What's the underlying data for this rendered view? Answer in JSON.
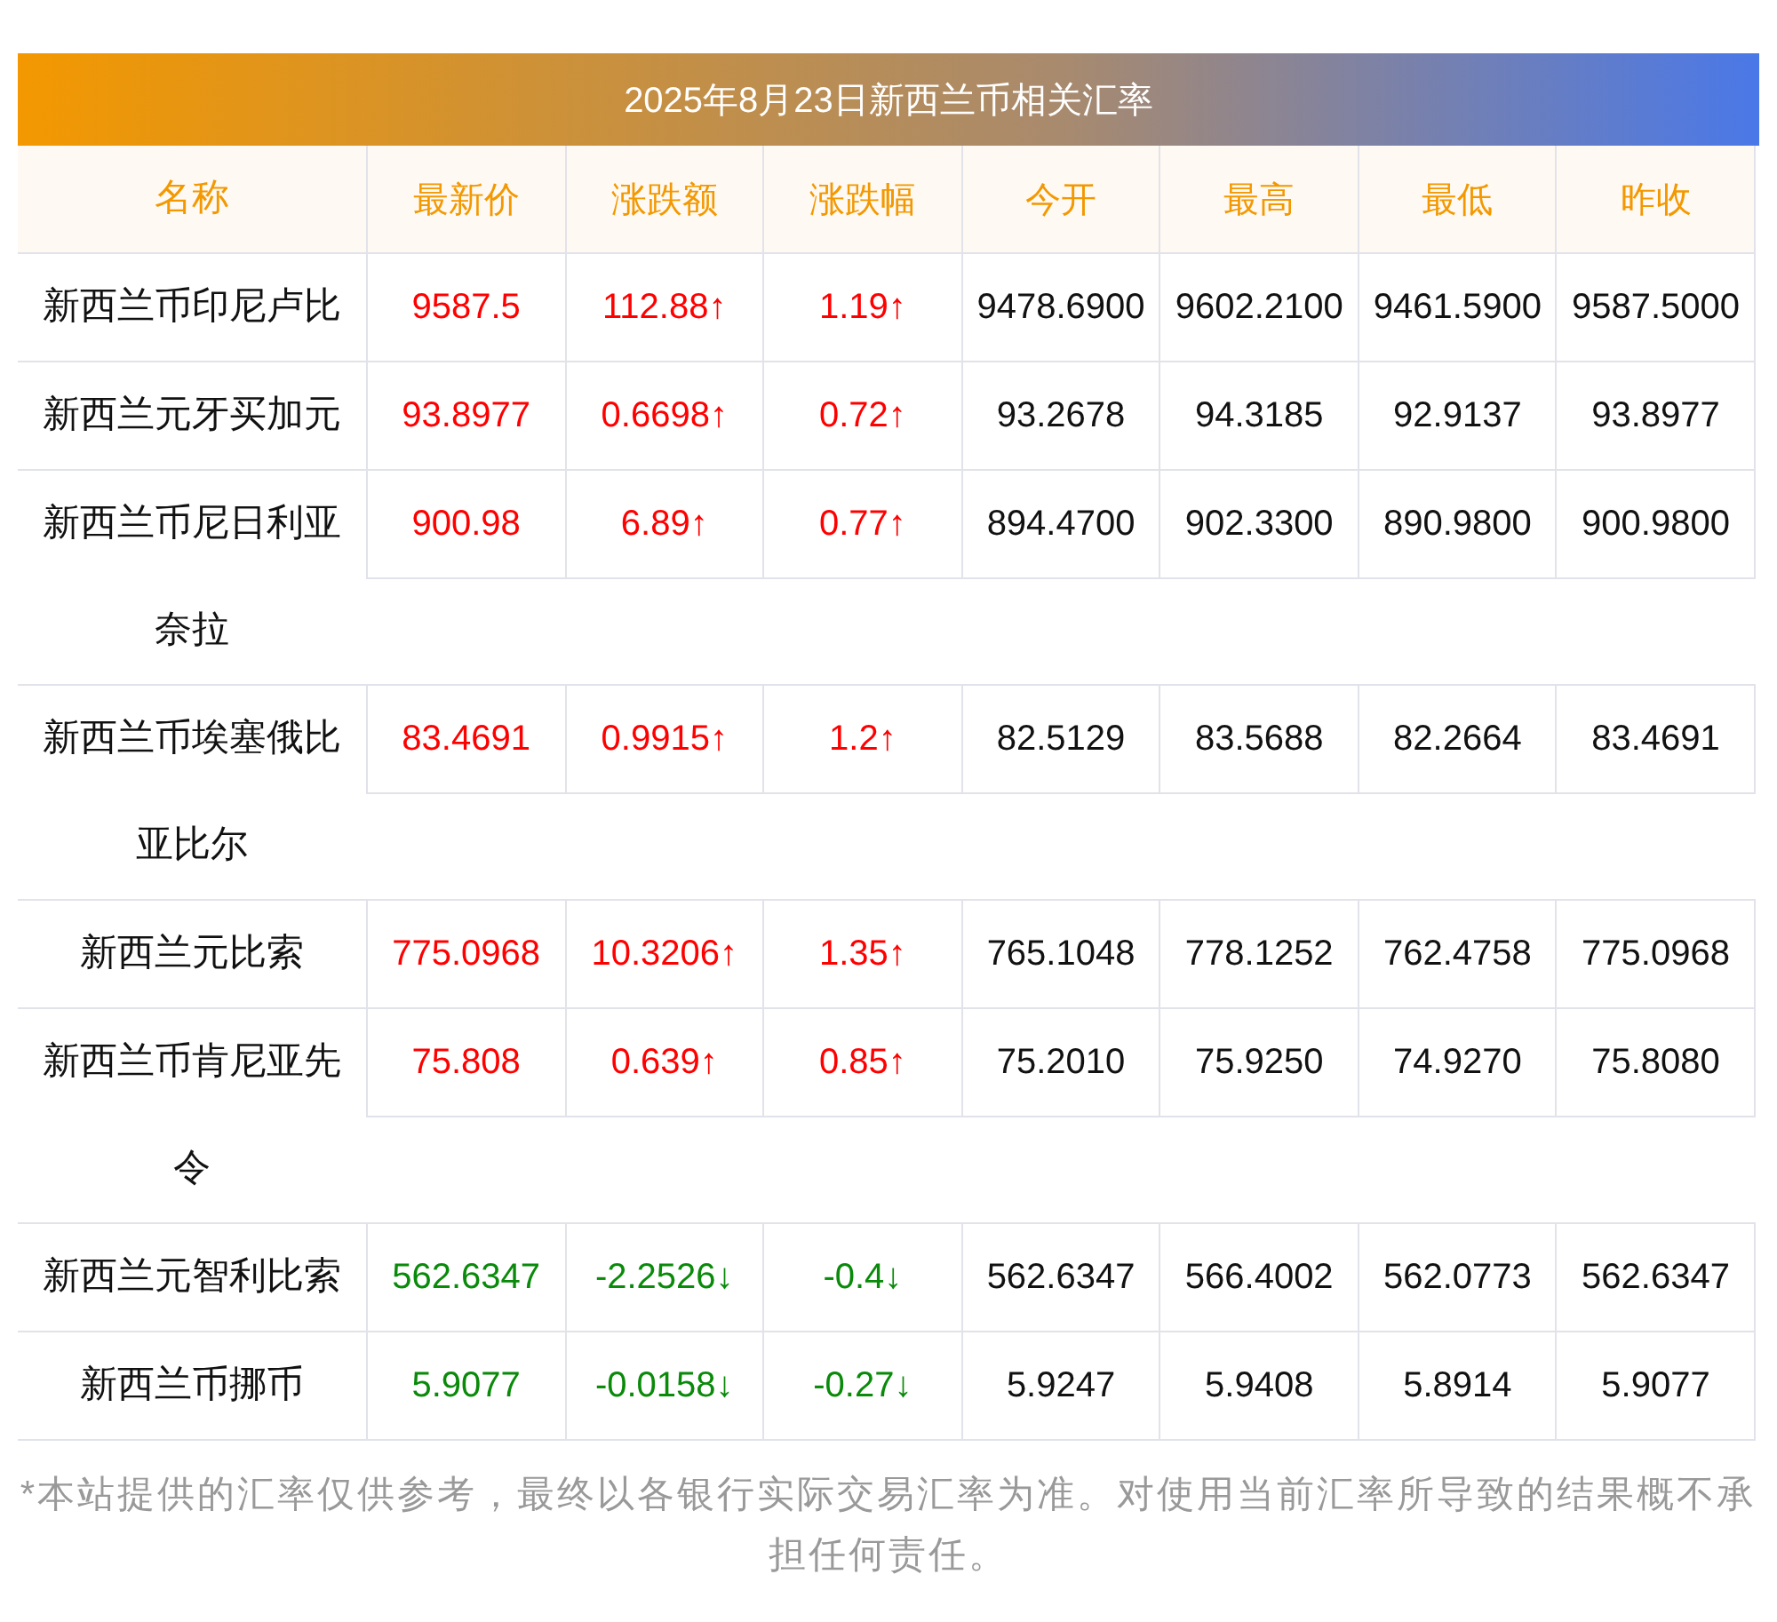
{
  "title": "2025年8月23日新西兰币相关汇率",
  "columns": [
    "名称",
    "最新价",
    "涨跌额",
    "涨跌幅",
    "今开",
    "最高",
    "最低",
    "昨收"
  ],
  "rows": [
    {
      "name": "新西兰币印尼卢比",
      "rising": true,
      "latest": "9587.5",
      "change": "112.88↑",
      "change_pct": "1.19↑",
      "open": "9478.6900",
      "high": "9602.2100",
      "low": "9461.5900",
      "prev_close": "9587.5000"
    },
    {
      "name": "新西兰元牙买加元",
      "rising": true,
      "latest": "93.8977",
      "change": "0.6698↑",
      "change_pct": "0.72↑",
      "open": "93.2678",
      "high": "94.3185",
      "low": "92.9137",
      "prev_close": "93.8977"
    },
    {
      "name": "新西兰币尼日利亚奈拉",
      "rising": true,
      "latest": "900.98",
      "change": "6.89↑",
      "change_pct": "0.77↑",
      "open": "894.4700",
      "high": "902.3300",
      "low": "890.9800",
      "prev_close": "900.9800"
    },
    {
      "name": "新西兰币埃塞俄比亚比尔",
      "rising": true,
      "latest": "83.4691",
      "change": "0.9915↑",
      "change_pct": "1.2↑",
      "open": "82.5129",
      "high": "83.5688",
      "low": "82.2664",
      "prev_close": "83.4691"
    },
    {
      "name": "新西兰元比索",
      "rising": true,
      "latest": "775.0968",
      "change": "10.3206↑",
      "change_pct": "1.35↑",
      "open": "765.1048",
      "high": "778.1252",
      "low": "762.4758",
      "prev_close": "775.0968"
    },
    {
      "name": "新西兰币肯尼亚先令",
      "rising": true,
      "latest": "75.808",
      "change": "0.639↑",
      "change_pct": "0.85↑",
      "open": "75.2010",
      "high": "75.9250",
      "low": "74.9270",
      "prev_close": "75.8080"
    },
    {
      "name": "新西兰元智利比索",
      "rising": false,
      "latest": "562.6347",
      "change": "-2.2526↓",
      "change_pct": "-0.4↓",
      "open": "562.6347",
      "high": "566.4002",
      "low": "562.0773",
      "prev_close": "562.6347"
    },
    {
      "name": "新西兰币挪币",
      "rising": false,
      "latest": "5.9077",
      "change": "-0.0158↓",
      "change_pct": "-0.27↓",
      "open": "5.9247",
      "high": "5.9408",
      "low": "5.8914",
      "prev_close": "5.9077"
    }
  ],
  "note": "*本站提供的汇率仅供参考，最终以各银行实际交易汇率为准。对使用当前汇率所导致的结果概不承担任何责任。"
}
